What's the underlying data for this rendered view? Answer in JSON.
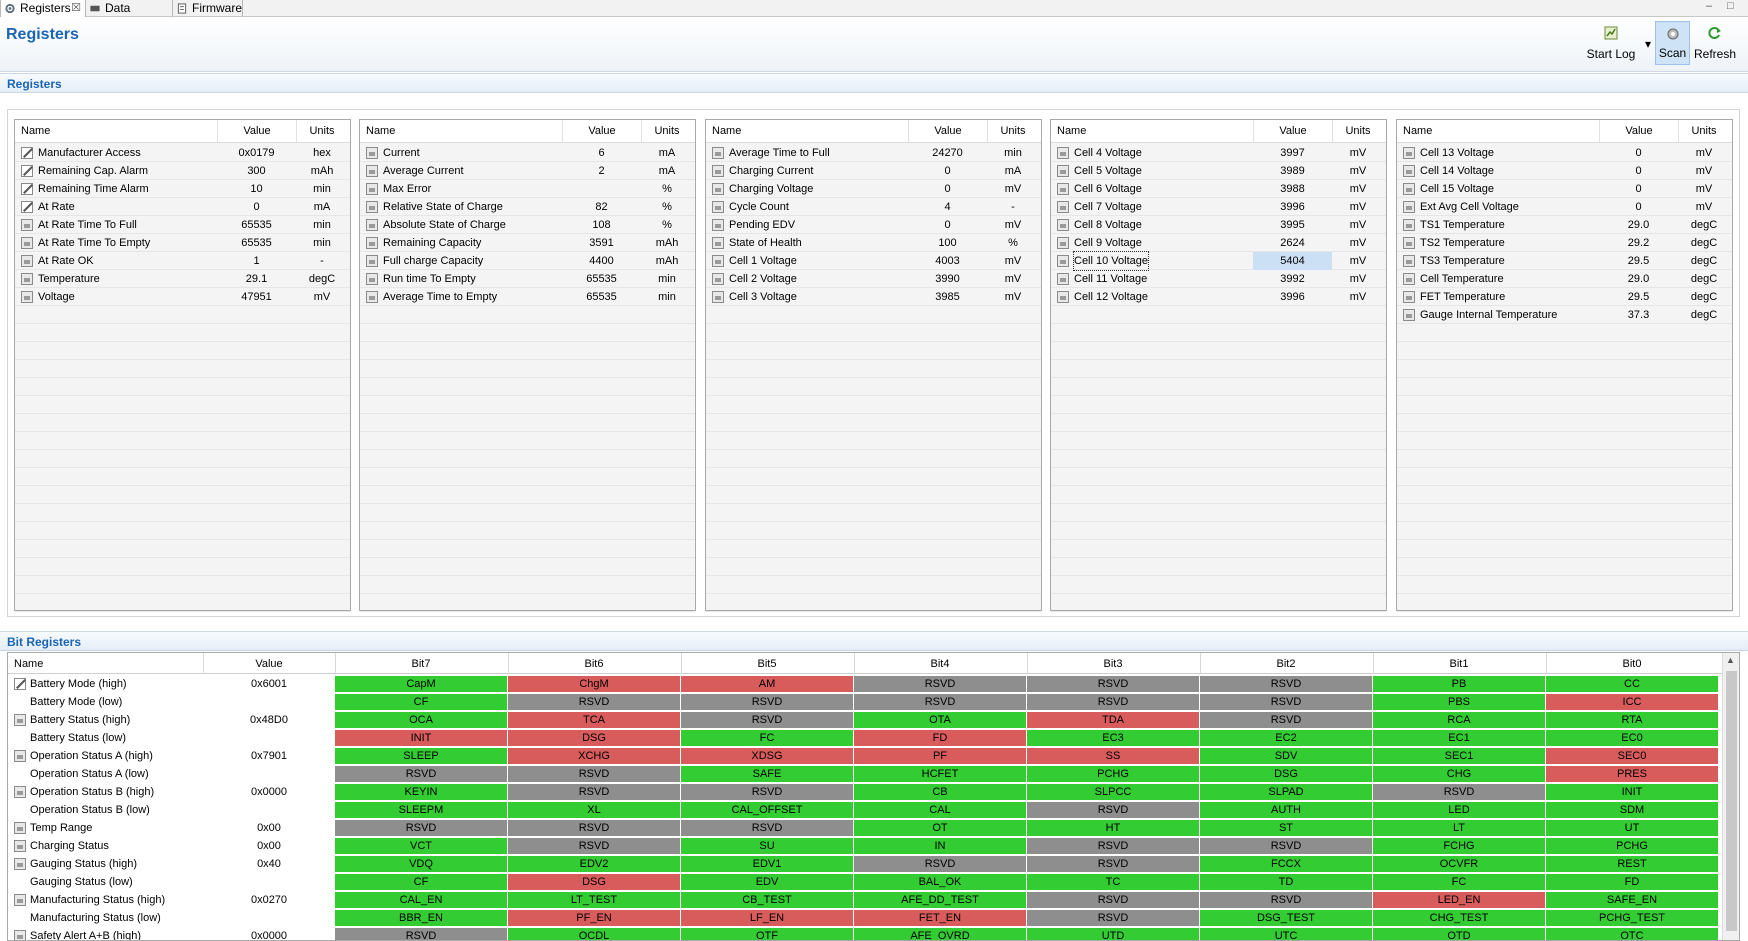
{
  "tabs": [
    {
      "label": "Registers",
      "icon": "gear-icon",
      "close": "☒"
    },
    {
      "label": "Data Memory",
      "icon": "chip-icon"
    },
    {
      "label": "Firmware",
      "icon": "document-icon"
    }
  ],
  "window_controls": {
    "minimize": "–",
    "maximize": "□"
  },
  "header": {
    "title": "Registers"
  },
  "toolbar": {
    "start_log": "Start Log",
    "dropdown": "▾",
    "scan": "Scan",
    "refresh": "Refresh"
  },
  "registers_section": {
    "title": "Registers"
  },
  "bit_section": {
    "title": "Bit Registers"
  },
  "register_columns": {
    "name": "Name",
    "value": "Value",
    "units": "Units"
  },
  "register_tables": [
    {
      "rows": [
        {
          "icon": "edit",
          "name": "Manufacturer Access",
          "value": "0x0179",
          "units": "hex"
        },
        {
          "icon": "edit",
          "name": "Remaining Cap. Alarm",
          "value": "300",
          "units": "mAh"
        },
        {
          "icon": "edit",
          "name": "Remaining Time Alarm",
          "value": "10",
          "units": "min"
        },
        {
          "icon": "edit",
          "name": "At Rate",
          "value": "0",
          "units": "mA"
        },
        {
          "icon": "lock",
          "name": "At Rate Time To Full",
          "value": "65535",
          "units": "min"
        },
        {
          "icon": "lock",
          "name": "At Rate Time To Empty",
          "value": "65535",
          "units": "min"
        },
        {
          "icon": "lock",
          "name": "At Rate OK",
          "value": "1",
          "units": "-"
        },
        {
          "icon": "lock",
          "name": "Temperature",
          "value": "29.1",
          "units": "degC"
        },
        {
          "icon": "lock",
          "name": "Voltage",
          "value": "47951",
          "units": "mV"
        }
      ]
    },
    {
      "rows": [
        {
          "icon": "lock",
          "name": "Current",
          "value": "6",
          "units": "mA"
        },
        {
          "icon": "lock",
          "name": "Average Current",
          "value": "2",
          "units": "mA"
        },
        {
          "icon": "lock",
          "name": "Max Error",
          "value": "",
          "units": "%"
        },
        {
          "icon": "lock",
          "name": "Relative State of Charge",
          "value": "82",
          "units": "%"
        },
        {
          "icon": "lock",
          "name": "Absolute State of Charge",
          "value": "108",
          "units": "%"
        },
        {
          "icon": "lock",
          "name": "Remaining Capacity",
          "value": "3591",
          "units": "mAh"
        },
        {
          "icon": "lock",
          "name": "Full charge Capacity",
          "value": "4400",
          "units": "mAh"
        },
        {
          "icon": "lock",
          "name": "Run time To Empty",
          "value": "65535",
          "units": "min"
        },
        {
          "icon": "lock",
          "name": "Average Time to Empty",
          "value": "65535",
          "units": "min"
        }
      ]
    },
    {
      "rows": [
        {
          "icon": "lock",
          "name": "Average Time to Full",
          "value": "24270",
          "units": "min"
        },
        {
          "icon": "lock",
          "name": "Charging Current",
          "value": "0",
          "units": "mA"
        },
        {
          "icon": "lock",
          "name": "Charging Voltage",
          "value": "0",
          "units": "mV"
        },
        {
          "icon": "lock",
          "name": "Cycle Count",
          "value": "4",
          "units": "-"
        },
        {
          "icon": "lock",
          "name": "Pending EDV",
          "value": "0",
          "units": "mV"
        },
        {
          "icon": "lock",
          "name": "State of Health",
          "value": "100",
          "units": "%"
        },
        {
          "icon": "lock",
          "name": "Cell 1 Voltage",
          "value": "4003",
          "units": "mV"
        },
        {
          "icon": "lock",
          "name": "Cell 2 Voltage",
          "value": "3990",
          "units": "mV"
        },
        {
          "icon": "lock",
          "name": "Cell 3 Voltage",
          "value": "3985",
          "units": "mV"
        }
      ]
    },
    {
      "rows": [
        {
          "icon": "lock",
          "name": "Cell 4 Voltage",
          "value": "3997",
          "units": "mV"
        },
        {
          "icon": "lock",
          "name": "Cell 5 Voltage",
          "value": "3989",
          "units": "mV"
        },
        {
          "icon": "lock",
          "name": "Cell 6 Voltage",
          "value": "3988",
          "units": "mV"
        },
        {
          "icon": "lock",
          "name": "Cell 7 Voltage",
          "value": "3996",
          "units": "mV"
        },
        {
          "icon": "lock",
          "name": "Cell 8 Voltage",
          "value": "3995",
          "units": "mV"
        },
        {
          "icon": "lock",
          "name": "Cell 9 Voltage",
          "value": "2624",
          "units": "mV"
        },
        {
          "icon": "lock",
          "name": "Cell 10 Voltage",
          "value": "5404",
          "units": "mV",
          "selected": true
        },
        {
          "icon": "lock",
          "name": "Cell 11 Voltage",
          "value": "3992",
          "units": "mV"
        },
        {
          "icon": "lock",
          "name": "Cell 12 Voltage",
          "value": "3996",
          "units": "mV"
        }
      ]
    },
    {
      "rows": [
        {
          "icon": "lock",
          "name": "Cell 13 Voltage",
          "value": "0",
          "units": "mV"
        },
        {
          "icon": "lock",
          "name": "Cell 14 Voltage",
          "value": "0",
          "units": "mV"
        },
        {
          "icon": "lock",
          "name": "Cell 15 Voltage",
          "value": "0",
          "units": "mV"
        },
        {
          "icon": "lock",
          "name": "Ext Avg Cell Voltage",
          "value": "0",
          "units": "mV"
        },
        {
          "icon": "lock",
          "name": "TS1 Temperature",
          "value": "29.0",
          "units": "degC"
        },
        {
          "icon": "lock",
          "name": "TS2 Temperature",
          "value": "29.2",
          "units": "degC"
        },
        {
          "icon": "lock",
          "name": "TS3 Temperature",
          "value": "29.5",
          "units": "degC"
        },
        {
          "icon": "lock",
          "name": "Cell Temperature",
          "value": "29.0",
          "units": "degC"
        },
        {
          "icon": "lock",
          "name": "FET Temperature",
          "value": "29.5",
          "units": "degC"
        },
        {
          "icon": "lock",
          "name": "Gauge Internal Temperature",
          "value": "37.3",
          "units": "degC"
        }
      ]
    }
  ],
  "bit_columns": [
    "Name",
    "Value",
    "Bit7",
    "Bit6",
    "Bit5",
    "Bit4",
    "Bit3",
    "Bit2",
    "Bit1",
    "Bit0"
  ],
  "bit_colors": {
    "g": "#33cc33",
    "r": "#d85c5c",
    "y": "#8e8e8e"
  },
  "bit_rows": [
    {
      "icon": "edit",
      "name": "Battery Mode (high)",
      "value": "0x6001",
      "bits": [
        [
          "CapM",
          "g"
        ],
        [
          "ChgM",
          "r"
        ],
        [
          "AM",
          "r"
        ],
        [
          "RSVD",
          "y"
        ],
        [
          "RSVD",
          "y"
        ],
        [
          "RSVD",
          "y"
        ],
        [
          "PB",
          "g"
        ],
        [
          "CC",
          "g"
        ]
      ]
    },
    {
      "icon": "",
      "name": "Battery Mode (low)",
      "value": "",
      "bits": [
        [
          "CF",
          "g"
        ],
        [
          "RSVD",
          "y"
        ],
        [
          "RSVD",
          "y"
        ],
        [
          "RSVD",
          "y"
        ],
        [
          "RSVD",
          "y"
        ],
        [
          "RSVD",
          "y"
        ],
        [
          "PBS",
          "g"
        ],
        [
          "ICC",
          "r"
        ]
      ]
    },
    {
      "icon": "lock",
      "name": "Battery Status (high)",
      "value": "0x48D0",
      "bits": [
        [
          "OCA",
          "g"
        ],
        [
          "TCA",
          "r"
        ],
        [
          "RSVD",
          "y"
        ],
        [
          "OTA",
          "g"
        ],
        [
          "TDA",
          "r"
        ],
        [
          "RSVD",
          "y"
        ],
        [
          "RCA",
          "g"
        ],
        [
          "RTA",
          "g"
        ]
      ]
    },
    {
      "icon": "",
      "name": "Battery Status (low)",
      "value": "",
      "bits": [
        [
          "INIT",
          "r"
        ],
        [
          "DSG",
          "r"
        ],
        [
          "FC",
          "g"
        ],
        [
          "FD",
          "r"
        ],
        [
          "EC3",
          "g"
        ],
        [
          "EC2",
          "g"
        ],
        [
          "EC1",
          "g"
        ],
        [
          "EC0",
          "g"
        ]
      ]
    },
    {
      "icon": "lock",
      "name": "Operation Status A (high)",
      "value": "0x7901",
      "bits": [
        [
          "SLEEP",
          "g"
        ],
        [
          "XCHG",
          "r"
        ],
        [
          "XDSG",
          "r"
        ],
        [
          "PF",
          "r"
        ],
        [
          "SS",
          "r"
        ],
        [
          "SDV",
          "g"
        ],
        [
          "SEC1",
          "g"
        ],
        [
          "SEC0",
          "r"
        ]
      ]
    },
    {
      "icon": "",
      "name": "Operation Status A (low)",
      "value": "",
      "bits": [
        [
          "RSVD",
          "y"
        ],
        [
          "RSVD",
          "y"
        ],
        [
          "SAFE",
          "g"
        ],
        [
          "HCFET",
          "g"
        ],
        [
          "PCHG",
          "g"
        ],
        [
          "DSG",
          "g"
        ],
        [
          "CHG",
          "g"
        ],
        [
          "PRES",
          "r"
        ]
      ]
    },
    {
      "icon": "lock",
      "name": "Operation Status B (high)",
      "value": "0x0000",
      "bits": [
        [
          "KEYIN",
          "g"
        ],
        [
          "RSVD",
          "y"
        ],
        [
          "RSVD",
          "y"
        ],
        [
          "CB",
          "g"
        ],
        [
          "SLPCC",
          "g"
        ],
        [
          "SLPAD",
          "g"
        ],
        [
          "RSVD",
          "y"
        ],
        [
          "INIT",
          "g"
        ]
      ]
    },
    {
      "icon": "",
      "name": "Operation Status B (low)",
      "value": "",
      "bits": [
        [
          "SLEEPM",
          "g"
        ],
        [
          "XL",
          "g"
        ],
        [
          "CAL_OFFSET",
          "g"
        ],
        [
          "CAL",
          "g"
        ],
        [
          "RSVD",
          "y"
        ],
        [
          "AUTH",
          "g"
        ],
        [
          "LED",
          "g"
        ],
        [
          "SDM",
          "g"
        ]
      ]
    },
    {
      "icon": "lock",
      "name": "Temp Range",
      "value": "0x00",
      "bits": [
        [
          "RSVD",
          "y"
        ],
        [
          "RSVD",
          "y"
        ],
        [
          "RSVD",
          "y"
        ],
        [
          "OT",
          "g"
        ],
        [
          "HT",
          "g"
        ],
        [
          "ST",
          "g"
        ],
        [
          "LT",
          "g"
        ],
        [
          "UT",
          "g"
        ]
      ]
    },
    {
      "icon": "lock",
      "name": "Charging Status",
      "value": "0x00",
      "bits": [
        [
          "VCT",
          "g"
        ],
        [
          "RSVD",
          "y"
        ],
        [
          "SU",
          "g"
        ],
        [
          "IN",
          "g"
        ],
        [
          "RSVD",
          "y"
        ],
        [
          "RSVD",
          "y"
        ],
        [
          "FCHG",
          "g"
        ],
        [
          "PCHG",
          "g"
        ]
      ]
    },
    {
      "icon": "lock",
      "name": "Gauging Status (high)",
      "value": "0x40",
      "bits": [
        [
          "VDQ",
          "g"
        ],
        [
          "EDV2",
          "g"
        ],
        [
          "EDV1",
          "g"
        ],
        [
          "RSVD",
          "y"
        ],
        [
          "RSVD",
          "y"
        ],
        [
          "FCCX",
          "g"
        ],
        [
          "OCVFR",
          "g"
        ],
        [
          "REST",
          "g"
        ]
      ]
    },
    {
      "icon": "",
      "name": "Gauging Status (low)",
      "value": "",
      "bits": [
        [
          "CF",
          "g"
        ],
        [
          "DSG",
          "r"
        ],
        [
          "EDV",
          "g"
        ],
        [
          "BAL_OK",
          "g"
        ],
        [
          "TC",
          "g"
        ],
        [
          "TD",
          "g"
        ],
        [
          "FC",
          "g"
        ],
        [
          "FD",
          "g"
        ]
      ]
    },
    {
      "icon": "lock",
      "name": "Manufacturing Status (high)",
      "value": "0x0270",
      "bits": [
        [
          "CAL_EN",
          "g"
        ],
        [
          "LT_TEST",
          "g"
        ],
        [
          "CB_TEST",
          "g"
        ],
        [
          "AFE_DD_TEST",
          "g"
        ],
        [
          "RSVD",
          "y"
        ],
        [
          "RSVD",
          "y"
        ],
        [
          "LED_EN",
          "r"
        ],
        [
          "SAFE_EN",
          "g"
        ]
      ]
    },
    {
      "icon": "",
      "name": "Manufacturing Status (low)",
      "value": "",
      "bits": [
        [
          "BBR_EN",
          "g"
        ],
        [
          "PF_EN",
          "r"
        ],
        [
          "LF_EN",
          "r"
        ],
        [
          "FET_EN",
          "r"
        ],
        [
          "RSVD",
          "y"
        ],
        [
          "DSG_TEST",
          "g"
        ],
        [
          "CHG_TEST",
          "g"
        ],
        [
          "PCHG_TEST",
          "g"
        ]
      ]
    },
    {
      "icon": "lock",
      "name": "Safety Alert A+B (high)",
      "value": "0x0000",
      "bits": [
        [
          "RSVD",
          "y"
        ],
        [
          "OCDL",
          "g"
        ],
        [
          "OTF",
          "g"
        ],
        [
          "AFE_OVRD",
          "g"
        ],
        [
          "UTD",
          "g"
        ],
        [
          "UTC",
          "g"
        ],
        [
          "OTD",
          "g"
        ],
        [
          "OTC",
          "g"
        ]
      ]
    }
  ],
  "scroll": {
    "up_arrow": "▲"
  }
}
